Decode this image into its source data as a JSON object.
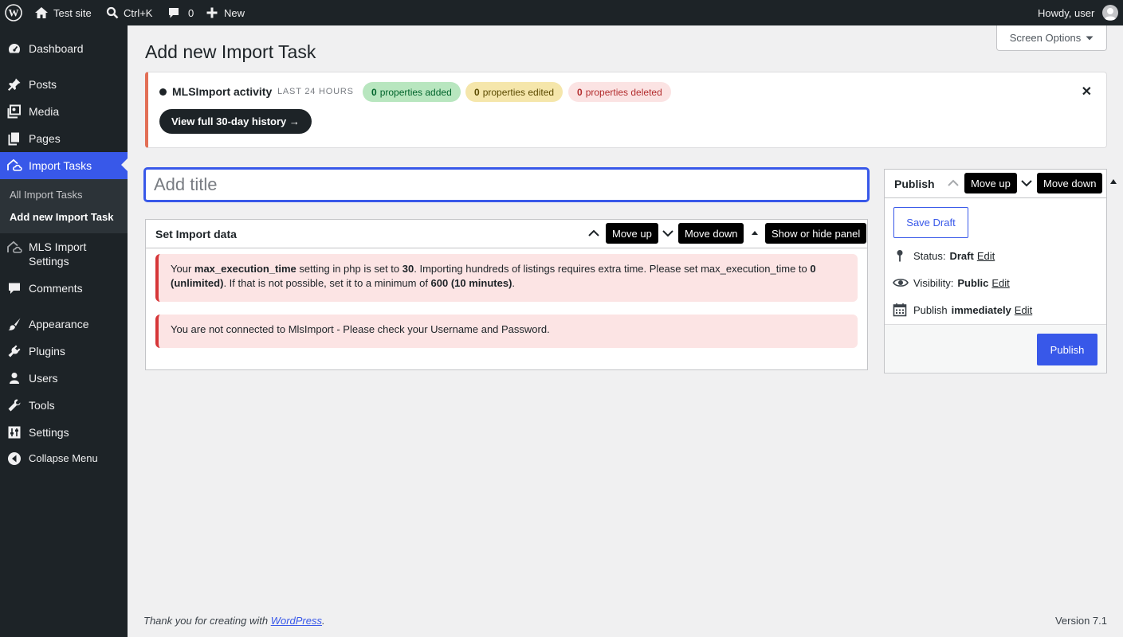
{
  "adminbar": {
    "site_name": "Test site",
    "search_shortcut": "Ctrl+K",
    "comments_count": "0",
    "new_label": "New",
    "howdy": "Howdy, user"
  },
  "sidebar": {
    "items": [
      {
        "label": "Dashboard",
        "icon": "dashboard-icon"
      },
      {
        "label": "Posts",
        "icon": "pin-icon"
      },
      {
        "label": "Media",
        "icon": "media-icon"
      },
      {
        "label": "Pages",
        "icon": "pages-icon"
      },
      {
        "label": "Import Tasks",
        "icon": "import-icon"
      },
      {
        "label": "MLS Import Settings",
        "icon": "cloud-icon"
      },
      {
        "label": "Comments",
        "icon": "comment-icon"
      },
      {
        "label": "Appearance",
        "icon": "brush-icon"
      },
      {
        "label": "Plugins",
        "icon": "plugin-icon"
      },
      {
        "label": "Users",
        "icon": "user-icon"
      },
      {
        "label": "Tools",
        "icon": "wrench-icon"
      },
      {
        "label": "Settings",
        "icon": "settings-icon"
      }
    ],
    "submenu": [
      "All Import Tasks",
      "Add new Import Task"
    ],
    "collapse": "Collapse Menu"
  },
  "screen_options": "Screen Options",
  "page_title": "Add new Import Task",
  "activity": {
    "title": "MLSImport activity",
    "period": "LAST 24 HOURS",
    "added_count": "0",
    "added_label": "properties added",
    "edited_count": "0",
    "edited_label": "properties edited",
    "deleted_count": "0",
    "deleted_label": "properties deleted",
    "history_button": "View full 30-day history →",
    "dismiss": "✕"
  },
  "title_input": {
    "placeholder": "Add title",
    "value": ""
  },
  "import_box": {
    "title": "Set Import data",
    "move_up": "Move up",
    "move_down": "Move down",
    "toggle": "Show or hide panel",
    "notice1": {
      "t1": "Your ",
      "b1": "max_execution_time",
      "t2": " setting in php is set to ",
      "b2": "30",
      "t3": ". Importing hundreds of listings requires extra time. Please set max_execution_time to ",
      "b3": "0 (unlimited)",
      "t4": ". If that is not possible, set it to a minimum of ",
      "b4": "600 (10 minutes)",
      "t5": "."
    },
    "notice2": "You are not connected to MlsImport - Please check your Username and Password."
  },
  "publish_box": {
    "title": "Publish",
    "move_up": "Move up",
    "move_down": "Move down",
    "save_draft": "Save Draft",
    "status_label": "Status:",
    "status_value": "Draft",
    "visibility_label": "Visibility:",
    "visibility_value": "Public",
    "publish_label": "Publish",
    "publish_value": "immediately",
    "edit": "Edit",
    "publish_button": "Publish"
  },
  "footer": {
    "thanks_pre": "Thank you for creating with ",
    "thanks_link": "WordPress",
    "thanks_post": ".",
    "version": "Version 7.1"
  }
}
